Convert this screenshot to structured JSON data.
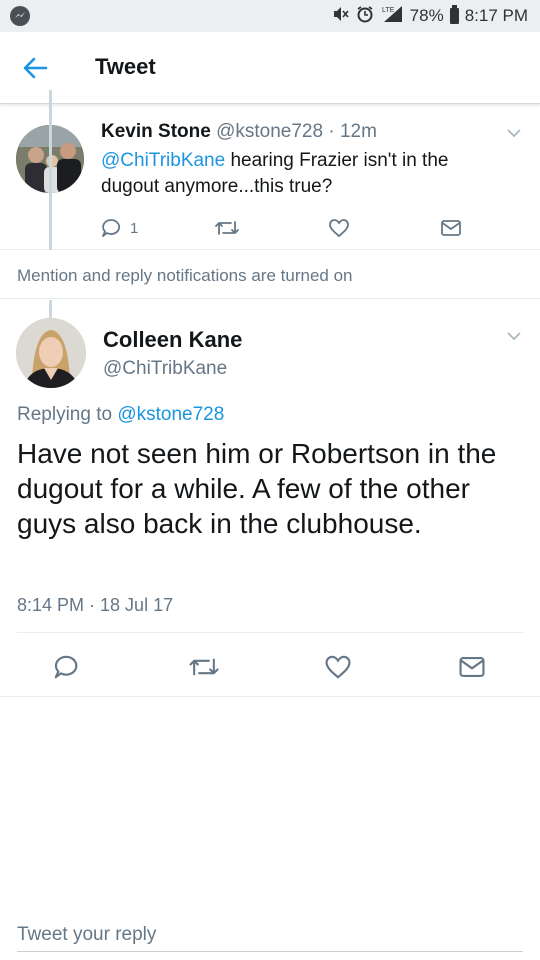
{
  "status_bar": {
    "battery": "78%",
    "time": "8:17 PM",
    "network": "LTE"
  },
  "header": {
    "title": "Tweet"
  },
  "parent_tweet": {
    "author_name": "Kevin Stone",
    "author_handle": "@kstone728",
    "separator": " · ",
    "age": "12m",
    "mention": "@ChiTribKane",
    "text": " hearing Frazier isn't in the dugout anymore...this true?",
    "reply_count": "1"
  },
  "notification": {
    "text": "Mention and reply notifications are turned on"
  },
  "main_tweet": {
    "author_name": "Colleen Kane",
    "author_handle": "@ChiTribKane",
    "replying_prefix": "Replying to ",
    "replying_to": "@kstone728",
    "text": "Have not seen him or Robertson in the dugout for a while. A few of the other guys also back in the clubhouse.",
    "timestamp": "8:14 PM · 18 Jul 17"
  },
  "composer": {
    "placeholder": "Tweet your reply"
  },
  "colors": {
    "link": "#1b95e0",
    "secondary_text": "#657786",
    "divider": "#e6ecf0",
    "status_bar_bg": "#eceff1"
  },
  "icons": [
    "messenger-icon",
    "mute-icon",
    "alarm-icon",
    "signal-icon",
    "battery-icon",
    "back-arrow-icon",
    "chevron-down-icon",
    "reply-icon",
    "retweet-icon",
    "like-icon",
    "dm-icon"
  ]
}
